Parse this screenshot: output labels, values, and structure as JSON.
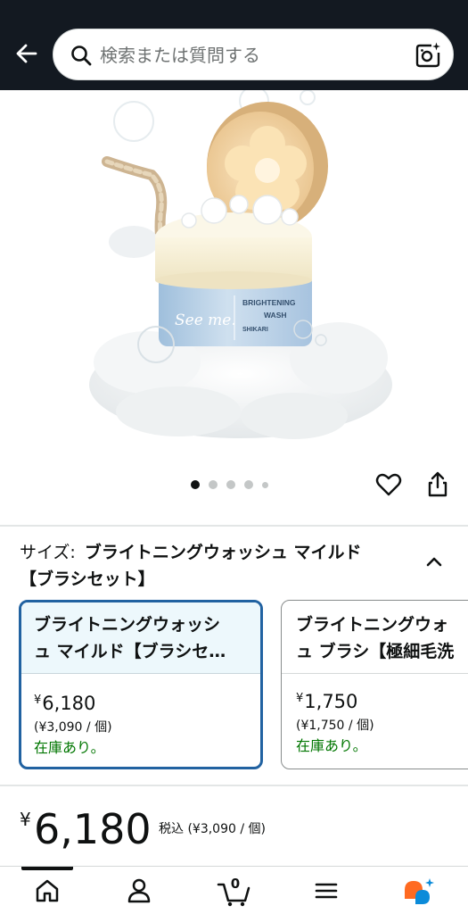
{
  "header": {
    "search_placeholder": "検索または質問する"
  },
  "carousel": {
    "total_dots": 5,
    "active_index": 0
  },
  "product_image": {
    "brand_text": "See me.",
    "jar_line1": "BRIGHTENING",
    "jar_line2": "WASH",
    "jar_small": "SHIKARI"
  },
  "size": {
    "label": "サイズ:",
    "selected_value": "ブライトニングウォッシュ マイルド【ブラシセット】",
    "selected_line1": "ブライトニングウォッシュ マイルド",
    "selected_line2": "【ブラシセット】"
  },
  "options": [
    {
      "title_line1": "ブライトニングウォッシ",
      "title_line2": "ュ マイルド【ブラシセ…",
      "price": "6,180",
      "unit_price": "(¥3,090 / 個)",
      "stock": "在庫あり。",
      "selected": true
    },
    {
      "title_line1": "ブライトニングウォ",
      "title_line2": "ュ ブラシ【極細毛洗",
      "price": "1,750",
      "unit_price": "(¥1,750 / 個)",
      "stock": "在庫あり。",
      "selected": false
    }
  ],
  "price": {
    "currency": "¥",
    "amount": "6,180",
    "tax_note": "税込 (¥3,090 / 個)"
  },
  "bottom_nav": {
    "cart_count": "0",
    "active": "home"
  },
  "colors": {
    "header_bg": "#131921",
    "selected_border": "#2162a1",
    "in_stock": "#007600",
    "rufus_orange": "#ff6a21",
    "rufus_blue": "#0b8bd9"
  }
}
